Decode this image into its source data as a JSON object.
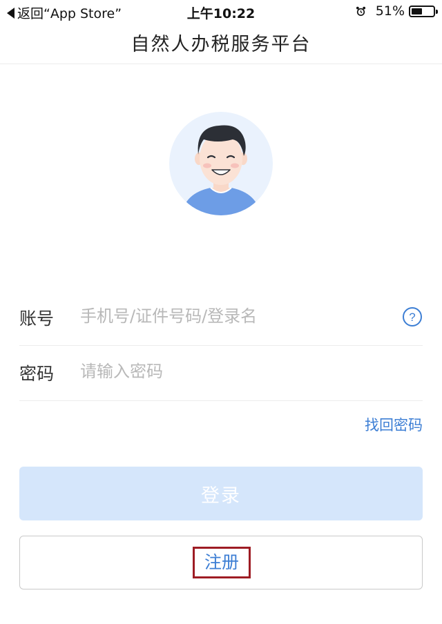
{
  "status_bar": {
    "back_text": "返回“App Store”",
    "time": "上午10:22",
    "battery_percent": "51%",
    "battery_level": 0.51
  },
  "nav": {
    "title": "自然人办税服务平台"
  },
  "form": {
    "account_label": "账号",
    "account_placeholder": "手机号/证件号码/登录名",
    "password_label": "密码",
    "password_placeholder": "请输入密码",
    "forgot_password": "找回密码"
  },
  "buttons": {
    "login": "登录",
    "register": "注册"
  },
  "colors": {
    "accent": "#3c7ed4",
    "login_disabled_bg": "#d5e6fb",
    "highlight_box": "#9e1c24"
  }
}
